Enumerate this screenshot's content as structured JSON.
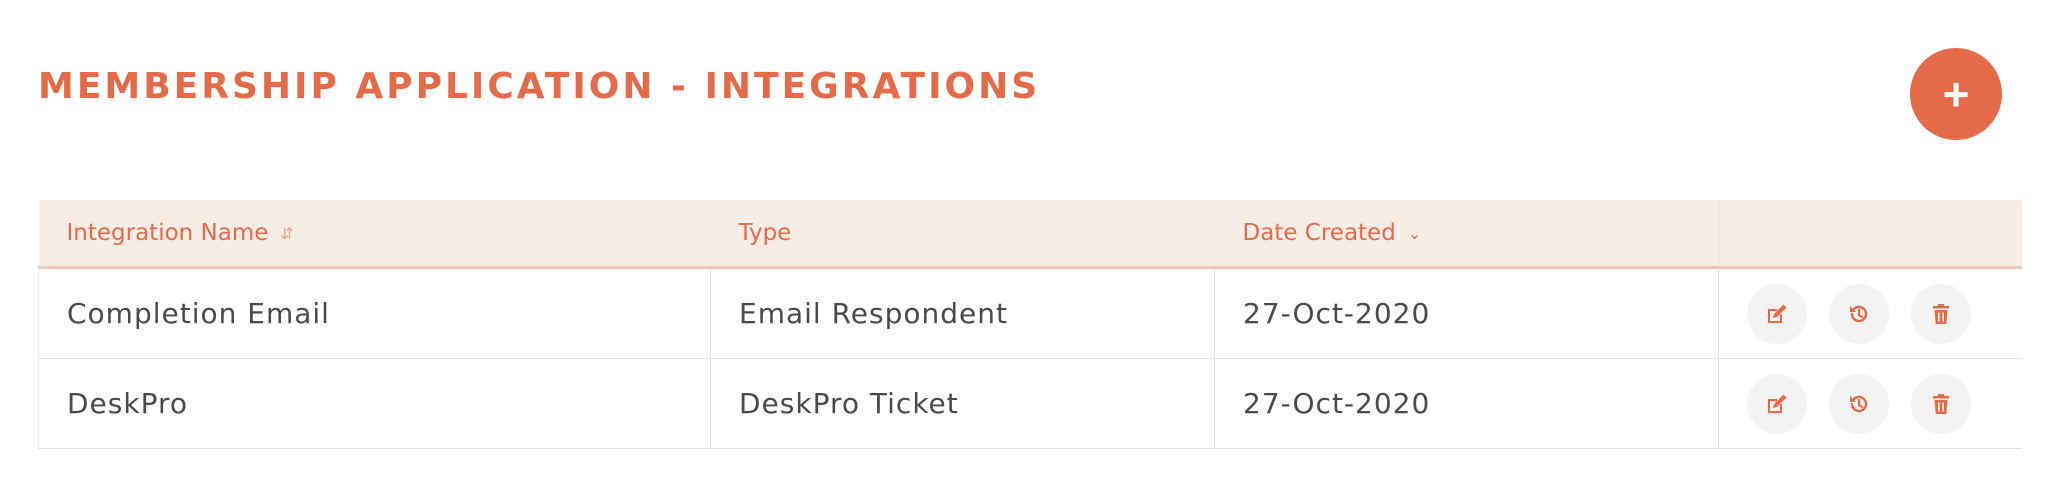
{
  "page": {
    "title": "MEMBERSHIP APPLICATION - INTEGRATIONS",
    "add_button_label": "+"
  },
  "table": {
    "headers": {
      "name": "Integration Name",
      "type": "Type",
      "date": "Date Created"
    },
    "sort": {
      "column": "date",
      "direction": "descending"
    },
    "rows": [
      {
        "name": "Completion Email",
        "type": "Email Respondent",
        "date": "27-Oct-2020"
      },
      {
        "name": "DeskPro",
        "type": "DeskPro Ticket",
        "date": "27-Oct-2020"
      }
    ],
    "row_actions": [
      "edit-icon",
      "history-icon",
      "trash-icon"
    ]
  },
  "colors": {
    "accent": "#e56a47",
    "header_bg": "#f7ede7",
    "text": "#4a4a4a",
    "action_bg": "#f3f3f3"
  }
}
